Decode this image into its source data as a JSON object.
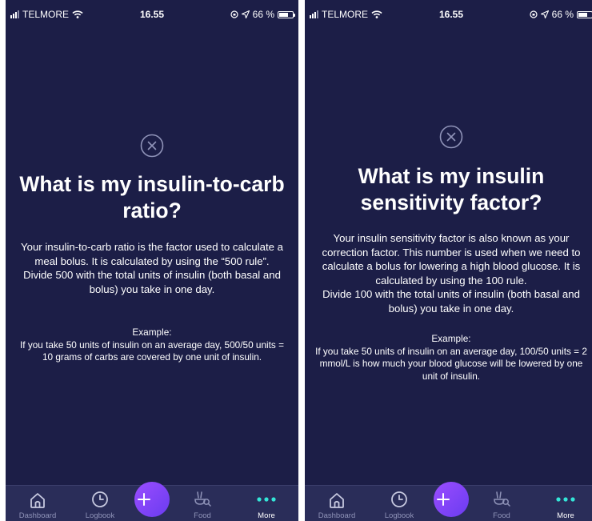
{
  "screens": [
    {
      "status": {
        "carrier": "TELMORE",
        "time": "16.55",
        "battery": "66 %",
        "battery_level": 0.66
      },
      "title": "What is my insulin-to-carb ratio?",
      "paragraphs": [
        "Your insulin-to-carb ratio is the factor used to calculate a meal bolus. It is calculated by using the “500 rule”.",
        "Divide 500 with the total units of insulin (both basal and bolus) you take in one day."
      ],
      "example": {
        "heading": "Example:",
        "text": "If you take 50 units of insulin on an average day, 500/50 units = 10 grams of carbs are covered by one unit of insulin."
      }
    },
    {
      "status": {
        "carrier": "TELMORE",
        "time": "16.55",
        "battery": "66 %",
        "battery_level": 0.66
      },
      "title": "What is my insulin sensitivity factor?",
      "paragraphs": [
        "Your insulin sensitivity factor is also known as your correction factor. This number is used when we need to calculate a bolus for lowering a high blood glucose. It is calculated by using the 100 rule.",
        "Divide 100 with the total units of insulin (both basal and bolus) you take in one day."
      ],
      "example": {
        "heading": "Example:",
        "text": "If you take 50 units of insulin on an average day, 100/50 units = 2 mmol/L is how much your blood glucose will be lowered by one unit of insulin."
      }
    }
  ],
  "tabbar": {
    "items": [
      {
        "label": "Dashboard",
        "icon": "home-icon"
      },
      {
        "label": "Logbook",
        "icon": "clock-icon"
      },
      {
        "label": "",
        "icon": "plus-icon"
      },
      {
        "label": "Food",
        "icon": "food-icon"
      },
      {
        "label": "More",
        "icon": "more-dots-icon",
        "active": true
      }
    ]
  },
  "colors": {
    "background": "#1c1e47",
    "tabbar": "#2a2d59",
    "text": "#ffffff",
    "inactive_tab": "#8f93b8",
    "accent_teal": "#34e6d8",
    "fab_gradient_start": "#9b4dff",
    "fab_gradient_end": "#6a3cf0"
  }
}
